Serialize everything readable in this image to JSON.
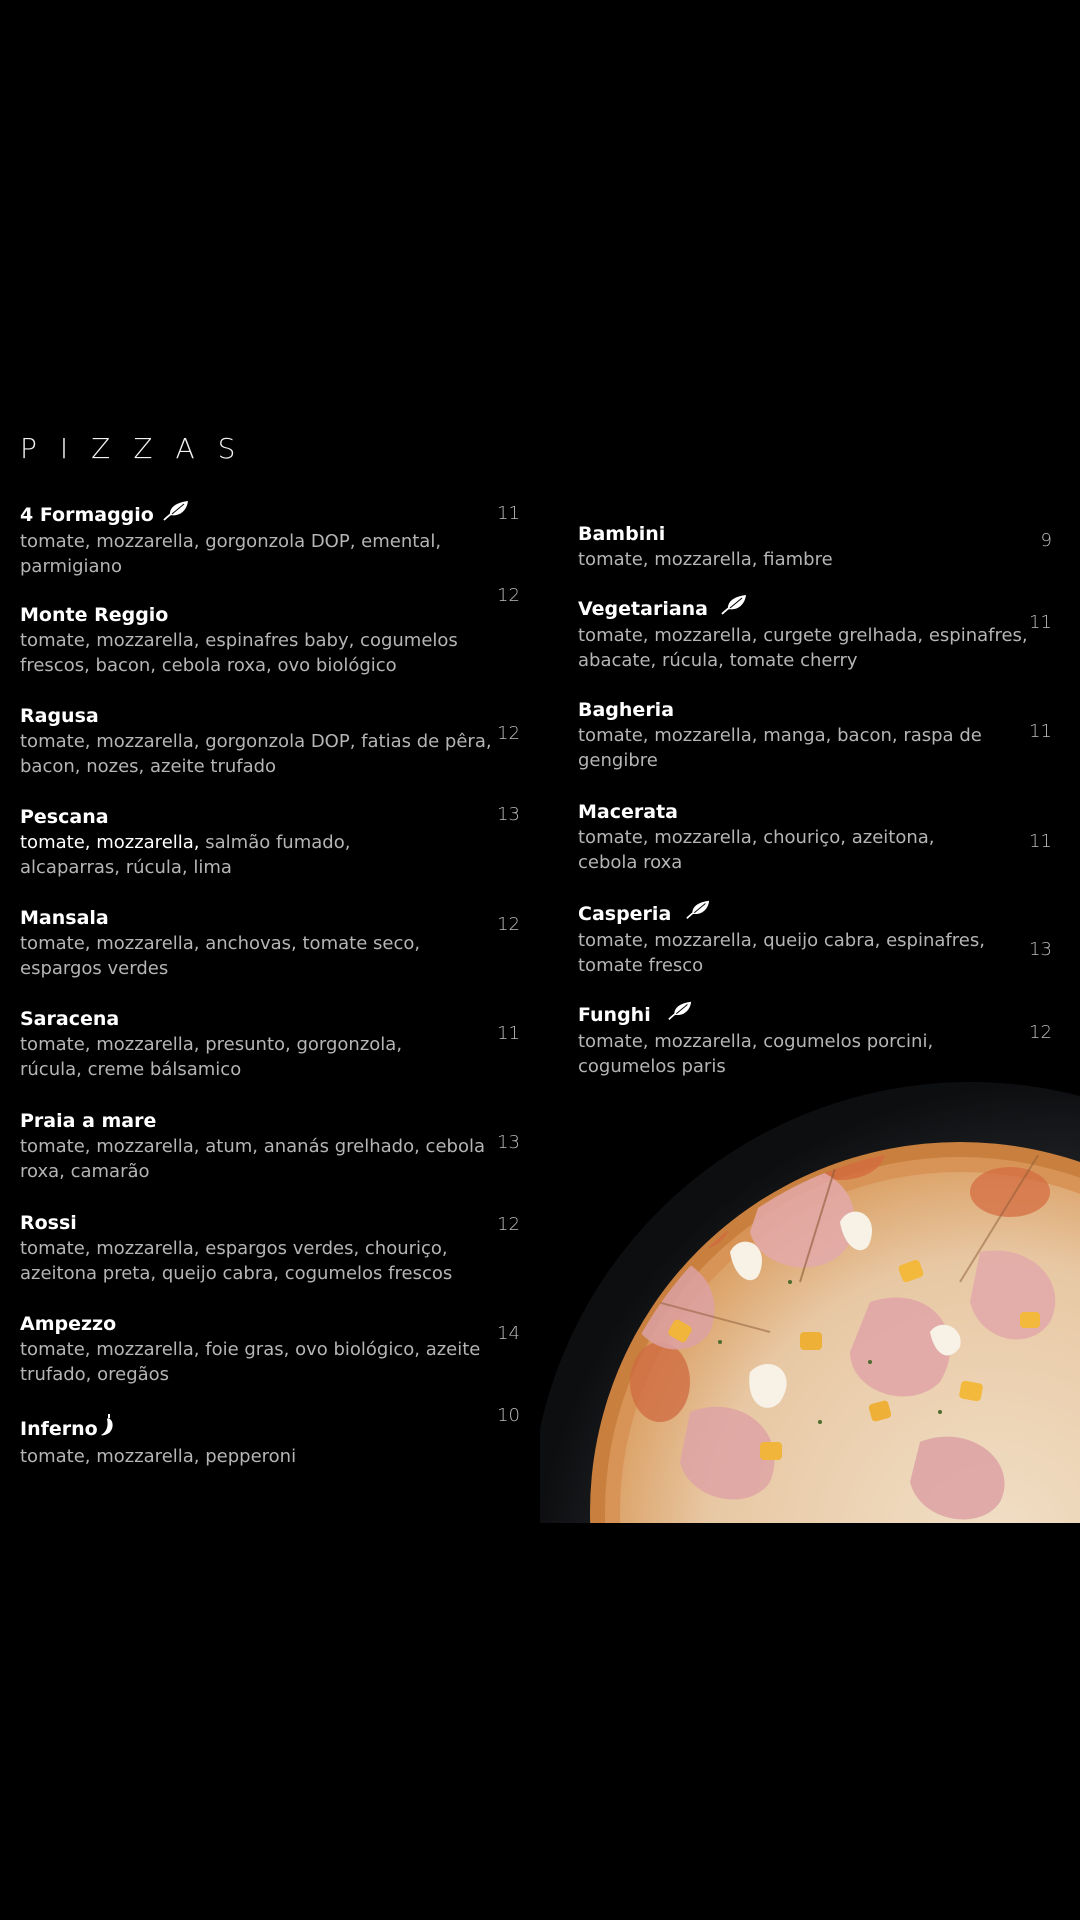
{
  "menu": {
    "section_title": "PIZZAS",
    "left": [
      {
        "name": "4 Formaggio",
        "icon": "leaf-icon",
        "desc": "tomate, mozzarella, gorgonzola DOP, emental, parmigiano",
        "price": "11"
      },
      {
        "name": "Monte Reggio",
        "desc": "tomate, mozzarella, espinafres baby, cogumelos frescos, bacon, cebola roxa, ovo biológico",
        "price": "12"
      },
      {
        "name": "Ragusa",
        "desc": "tomate, mozzarella, gorgonzola DOP, fatias de pêra, bacon, nozes, azeite trufado",
        "price": "12"
      },
      {
        "name": "Pescana",
        "desc_highlight": "tomate, mozzarella,",
        "desc": "salmão fumado, alcaparras, rúcula, lima",
        "price": "13"
      },
      {
        "name": "Mansala",
        "desc": "tomate, mozzarella, anchovas, tomate seco, espargos verdes",
        "price": "12"
      },
      {
        "name": "Saracena",
        "desc": "tomate, mozzarella, presunto, gorgonzola, rúcula, creme bálsamico",
        "price": "11"
      },
      {
        "name": "Praia a mare",
        "desc": "tomate, mozzarella, atum, ananás grelhado, cebola roxa, camarão",
        "price": "13"
      },
      {
        "name": "Rossi",
        "desc": "tomate, mozzarella, espargos verdes, chouriço, azeitona preta, queijo cabra, cogumelos frescos",
        "price": "12"
      },
      {
        "name": "Ampezzo",
        "desc": "tomate, mozzarella, foie gras, ovo biológico, azeite trufado, oregãos",
        "price": "14"
      },
      {
        "name": "Inferno",
        "icon": "chili-pepper-icon",
        "desc": "tomate, mozzarella, pepperoni",
        "price": "10"
      }
    ],
    "right": [
      {
        "name": "Bambini",
        "desc": "tomate, mozzarella, fiambre",
        "price": "9"
      },
      {
        "name": "Vegetariana",
        "icon": "leaf-icon",
        "desc": "tomate, mozzarella, curgete grelhada, espinafres, abacate, rúcula, tomate cherry",
        "price": "11"
      },
      {
        "name": "Bagheria",
        "desc": "tomate, mozzarella, manga, bacon, raspa de gengibre",
        "price": "11"
      },
      {
        "name": "Macerata",
        "desc": "tomate, mozzarella, chouriço, azeitona, cebola roxa",
        "price": "11"
      },
      {
        "name": "Casperia",
        "icon": "leaf-icon",
        "desc": "tomate, mozzarella, queijo cabra, espinafres, tomate fresco",
        "price": "13"
      },
      {
        "name": "Funghi",
        "icon": "leaf-icon",
        "desc": "tomate, mozzarella, cogumelos porcini, cogumelos paris",
        "price": "12"
      }
    ]
  },
  "photo": {
    "icon": "pizza-photo"
  }
}
